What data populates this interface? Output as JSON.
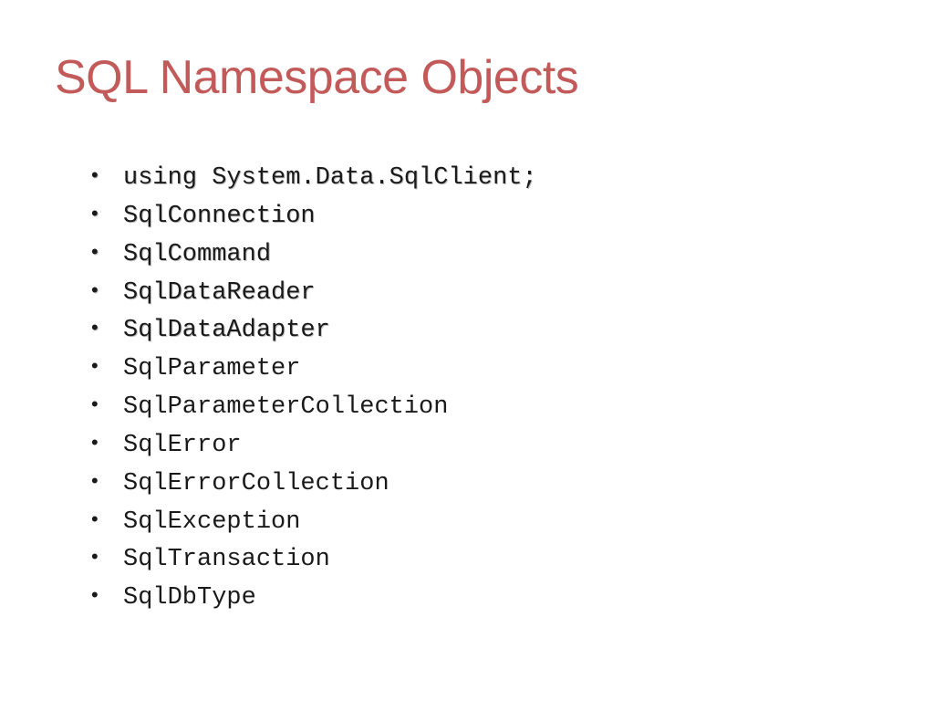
{
  "title": "SQL Namespace Objects",
  "items": [
    {
      "text": "using System.Data.SqlClient;",
      "shadow": true
    },
    {
      "text": "SqlConnection",
      "shadow": true
    },
    {
      "text": "SqlCommand",
      "shadow": true
    },
    {
      "text": "SqlDataReader",
      "shadow": true
    },
    {
      "text": "SqlDataAdapter",
      "shadow": true
    },
    {
      "text": "SqlParameter",
      "shadow": false
    },
    {
      "text": "SqlParameterCollection",
      "shadow": false
    },
    {
      "text": "SqlError",
      "shadow": false
    },
    {
      "text": "SqlErrorCollection",
      "shadow": false
    },
    {
      "text": "SqlException",
      "shadow": false
    },
    {
      "text": "SqlTransaction",
      "shadow": false
    },
    {
      "text": "SqlDbType",
      "shadow": false
    }
  ]
}
